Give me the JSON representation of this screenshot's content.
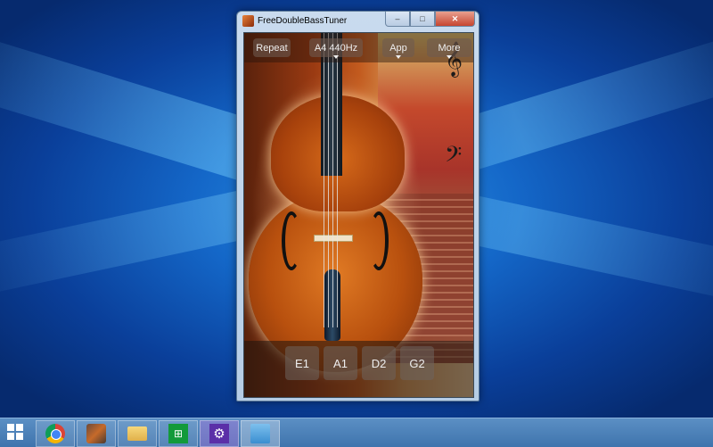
{
  "window": {
    "title": "FreeDoubleBassTuner",
    "controls": {
      "minimize": "–",
      "maximize": "□",
      "close": "✕"
    }
  },
  "app": {
    "top_buttons": [
      {
        "label": "Repeat",
        "has_dropdown": false
      },
      {
        "label": "A4 440Hz",
        "has_dropdown": true
      },
      {
        "label": "App",
        "has_dropdown": true
      },
      {
        "label": "More",
        "has_dropdown": true
      }
    ],
    "string_buttons": [
      {
        "label": "E1"
      },
      {
        "label": "A1"
      },
      {
        "label": "D2"
      },
      {
        "label": "G2"
      }
    ],
    "decor_notes": {
      "treble": "𝄞",
      "bass": "𝄢"
    }
  },
  "taskbar": {
    "items": [
      {
        "name": "start",
        "icon": "windows-logo-icon"
      },
      {
        "name": "chrome",
        "icon": "chrome-icon"
      },
      {
        "name": "double-bass-tuner",
        "icon": "double-bass-app-icon",
        "active": true
      },
      {
        "name": "file-explorer",
        "icon": "folder-icon"
      },
      {
        "name": "store",
        "icon": "store-icon"
      },
      {
        "name": "settings",
        "icon": "gear-icon"
      },
      {
        "name": "control-panel",
        "icon": "control-panel-icon"
      }
    ],
    "store_glyph": "⊞",
    "gear_glyph": "⚙"
  },
  "colors": {
    "desktop_blue": "#1467c8",
    "taskbar": "#4a80b8",
    "bass_orange": "#c25a1e"
  }
}
